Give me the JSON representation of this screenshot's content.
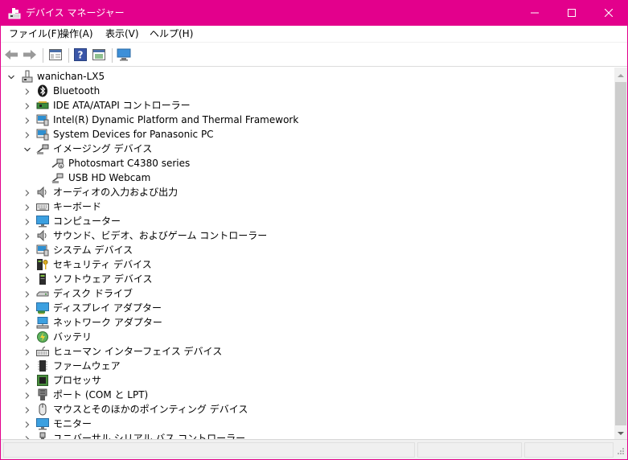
{
  "window": {
    "title": "デバイス マネージャー",
    "accent": "#e3008c",
    "controls": {
      "minimize": "minimize-icon",
      "maximize": "maximize-icon",
      "close": "close-icon"
    }
  },
  "menu": {
    "items": [
      {
        "label": "ファイル(F)"
      },
      {
        "label": "操作(A)"
      },
      {
        "label": "表示(V)"
      },
      {
        "label": "ヘルプ(H)"
      }
    ]
  },
  "toolbar": {
    "buttons": [
      {
        "icon": "back-arrow-icon"
      },
      {
        "icon": "forward-arrow-icon"
      },
      {
        "icon": "properties-window-icon"
      },
      {
        "icon": "help-icon"
      },
      {
        "icon": "properties-sheet-icon"
      },
      {
        "icon": "display-monitor-icon"
      }
    ]
  },
  "tree": {
    "root": {
      "label": "wanichan-LX5",
      "expanded": true,
      "icon": "computer-network-icon"
    },
    "items": [
      {
        "label": "Bluetooth",
        "icon": "bluetooth-icon",
        "expanded": false
      },
      {
        "label": "IDE ATA/ATAPI コントローラー",
        "icon": "ide-controller-icon",
        "expanded": false
      },
      {
        "label": "Intel(R) Dynamic Platform and Thermal Framework",
        "icon": "system-device-icon",
        "expanded": false
      },
      {
        "label": "System Devices for Panasonic PC",
        "icon": "system-device-icon",
        "expanded": false
      },
      {
        "label": "イメージング デバイス",
        "icon": "imaging-device-icon",
        "expanded": true,
        "children": [
          {
            "label": "Photosmart C4380 series",
            "icon": "camera-device-icon"
          },
          {
            "label": "USB HD Webcam",
            "icon": "camera-device-icon"
          }
        ]
      },
      {
        "label": "オーディオの入力および出力",
        "icon": "speaker-icon",
        "expanded": false
      },
      {
        "label": "キーボード",
        "icon": "keyboard-icon",
        "expanded": false
      },
      {
        "label": "コンピューター",
        "icon": "monitor-icon",
        "expanded": false
      },
      {
        "label": "サウンド、ビデオ、およびゲーム コントローラー",
        "icon": "speaker-icon",
        "expanded": false
      },
      {
        "label": "システム デバイス",
        "icon": "system-device-icon",
        "expanded": false
      },
      {
        "label": "セキュリティ デバイス",
        "icon": "security-key-icon",
        "expanded": false
      },
      {
        "label": "ソフトウェア デバイス",
        "icon": "software-device-icon",
        "expanded": false
      },
      {
        "label": "ディスク ドライブ",
        "icon": "disk-drive-icon",
        "expanded": false
      },
      {
        "label": "ディスプレイ アダプター",
        "icon": "display-adapter-icon",
        "expanded": false
      },
      {
        "label": "ネットワーク アダプター",
        "icon": "network-adapter-icon",
        "expanded": false
      },
      {
        "label": "バッテリ",
        "icon": "battery-icon",
        "expanded": false
      },
      {
        "label": "ヒューマン インターフェイス デバイス",
        "icon": "hid-icon",
        "expanded": false
      },
      {
        "label": "ファームウェア",
        "icon": "firmware-chip-icon",
        "expanded": false
      },
      {
        "label": "プロセッサ",
        "icon": "processor-chip-icon",
        "expanded": false
      },
      {
        "label": "ポート (COM と LPT)",
        "icon": "port-icon",
        "expanded": false
      },
      {
        "label": "マウスとそのほかのポインティング デバイス",
        "icon": "mouse-icon",
        "expanded": false
      },
      {
        "label": "モニター",
        "icon": "monitor-icon",
        "expanded": false
      },
      {
        "label": "ユニバーサル シリアル バス コントローラー",
        "icon": "usb-icon",
        "expanded": false
      }
    ]
  }
}
